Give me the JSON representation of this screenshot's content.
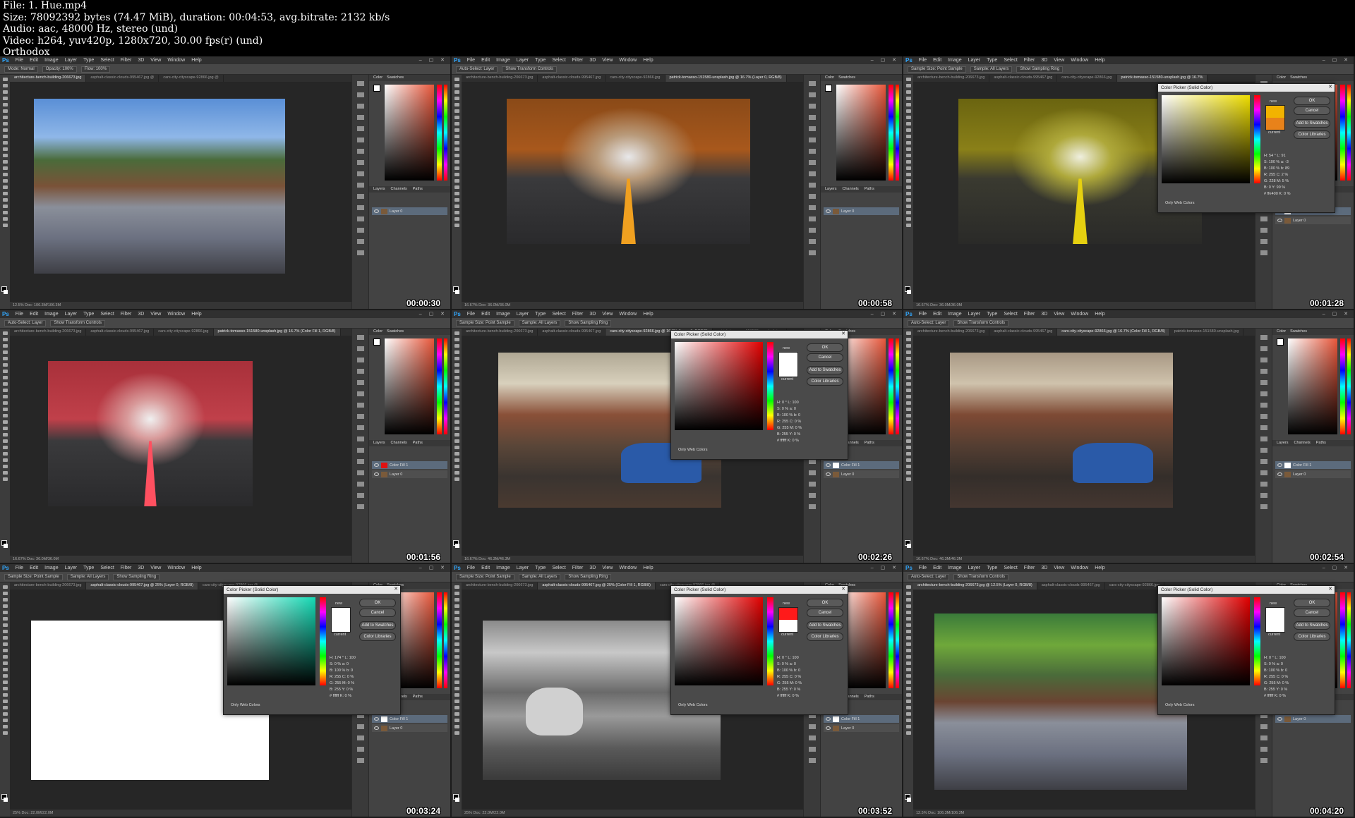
{
  "file_info": {
    "line1": "File: 1. Hue.mp4",
    "line2": "Size: 78092392 bytes (74.47 MiB), duration: 00:04:53, avg.bitrate: 2132 kb/s",
    "line3": "Audio: aac, 48000 Hz, stereo (und)",
    "line4": "Video: h264, yuv420p, 1280x720, 30.00 fps(r) (und)",
    "line5": "Orthodox"
  },
  "ps": {
    "logo": "Ps",
    "menus": [
      "File",
      "Edit",
      "Image",
      "Layer",
      "Type",
      "Select",
      "Filter",
      "3D",
      "View",
      "Window",
      "Help"
    ],
    "window_buttons": "– ▢ ✕",
    "panel_tabs": [
      "Color",
      "Swatches"
    ],
    "layer_tabs": [
      "Layers",
      "Channels",
      "Paths"
    ],
    "layer_names": [
      "Color Fill 1",
      "Layer 0"
    ],
    "dialog": {
      "title": "Color Picker (Solid Color)",
      "close": "✕",
      "new_label": "new",
      "current_label": "current",
      "ok": "OK",
      "cancel": "Cancel",
      "add_swatches": "Add to Swatches",
      "color_libraries": "Color Libraries",
      "only_web": "Only Web Colors"
    }
  },
  "frames": [
    {
      "tabs": [
        "architecture-bench-building-206673.jpg",
        "asphalt-classic-clouds-995467.jpg @",
        "cars-city-cityscape-92866.jpg @"
      ],
      "active_tab": 0,
      "options": [
        "Mode: Normal",
        "Opacity: 100%",
        "Flow: 100%"
      ],
      "status": "12.5%   Doc: 106.3M/106.3M",
      "timestamp": "00:00:30",
      "layers": [
        "Layer 0"
      ]
    },
    {
      "tabs": [
        "architecture-bench-building-206673.jpg",
        "asphalt-classic-clouds-995467.jpg",
        "cars-city-cityscape-92866.jpg",
        "patrick-tomasso-151580-unsplash.jpg @ 16.7% (Layer 0, RGB/8)"
      ],
      "active_tab": 3,
      "options": [
        "Auto-Select: Layer",
        "Show Transform Controls"
      ],
      "status": "16.67%   Doc: 36.0M/36.0M",
      "timestamp": "00:00:58",
      "layers": [
        "Layer 0"
      ]
    },
    {
      "tabs": [
        "architecture-bench-building-206673.jpg",
        "asphalt-classic-clouds-995467.jpg",
        "cars-city-cityscape-92866.jpg",
        "patrick-tomasso-151580-unsplash.jpg @ 16.7%"
      ],
      "active_tab": 3,
      "options": [
        "Sample Size: Point Sample",
        "Sample: All Layers",
        "Show Sampling Ring"
      ],
      "status": "16.67%   Doc: 36.0M/36.0M",
      "timestamp": "00:01:28",
      "layers": [
        "Color Fill 1",
        "Layer 0"
      ],
      "dialog": {
        "field_hue": "#eedd00",
        "new": "#f2b300",
        "current": "#e8821a",
        "values": [
          "H: 54 °   L: 91",
          "S: 100 %   a: -3",
          "B: 100 %   b: 89",
          "R: 255   C: 2 %",
          "G: 228   M: 5 %",
          "B: 0   Y: 99 %",
          "# ffe400   K: 0 %"
        ]
      }
    },
    {
      "tabs": [
        "architecture-bench-building-206673.jpg",
        "asphalt-classic-clouds-995467.jpg",
        "cars-city-cityscape-92866.jpg",
        "patrick-tomasso-151580-unsplash.jpg @ 16.7% (Color Fill 1, RGB/8)"
      ],
      "active_tab": 3,
      "options": [
        "Auto-Select: Layer",
        "Show Transform Controls"
      ],
      "status": "16.67%   Doc: 36.0M/36.0M",
      "timestamp": "00:01:56",
      "layers": [
        "Color Fill 1",
        "Layer 0"
      ],
      "blend": "Hue"
    },
    {
      "tabs": [
        "architecture-bench-building-206673.jpg",
        "asphalt-classic-clouds-995467.jpg",
        "cars-city-cityscape-92866.jpg @ 16.7% (Layer 0, RGB/8)",
        "patrick-tomasso-151580-unsplash.jpg"
      ],
      "active_tab": 2,
      "options": [
        "Sample Size: Point Sample",
        "Sample: All Layers",
        "Show Sampling Ring"
      ],
      "status": "16.67%   Doc: 46.3M/46.3M",
      "timestamp": "00:02:26",
      "layers": [
        "Color Fill 1",
        "Layer 0"
      ],
      "dialog": {
        "field_hue": "#e00000",
        "new": "#ffffff",
        "current": "#ffffff",
        "values": [
          "H: 0 °   L: 100",
          "S: 0 %   a: 0",
          "B: 100 %   b: 0",
          "R: 255   C: 0 %",
          "G: 255   M: 0 %",
          "B: 255   Y: 0 %",
          "# ffffff   K: 0 %"
        ]
      }
    },
    {
      "tabs": [
        "architecture-bench-building-206673.jpg",
        "asphalt-classic-clouds-995467.jpg",
        "cars-city-cityscape-92866.jpg @ 16.7% (Color Fill 1, RGB/8)",
        "patrick-tomasso-151580-unsplash.jpg"
      ],
      "active_tab": 2,
      "options": [
        "Auto-Select: Layer",
        "Show Transform Controls"
      ],
      "status": "16.67%   Doc: 46.3M/46.3M",
      "timestamp": "00:02:54",
      "layers": [
        "Color Fill 1",
        "Layer 0"
      ]
    },
    {
      "tabs": [
        "architecture-bench-building-206673.jpg",
        "asphalt-classic-clouds-995467.jpg @ 25% (Layer 0, RGB/8)",
        "cars-city-cityscape-92866.jpg @"
      ],
      "active_tab": 1,
      "options": [
        "Sample Size: Point Sample",
        "Sample: All Layers",
        "Show Sampling Ring"
      ],
      "status": "25%   Doc: 22.0M/22.0M",
      "timestamp": "00:03:24",
      "layers": [
        "Color Fill 1",
        "Layer 0"
      ],
      "dialog": {
        "field_hue": "#14d9b4",
        "new": "#ffffff",
        "current": "#ffffff",
        "values": [
          "H: 174 °   L: 100",
          "S: 0 %   a: 0",
          "B: 100 %   b: 0",
          "R: 255   C: 0 %",
          "G: 255   M: 0 %",
          "B: 255   Y: 0 %",
          "# ffffff   K: 0 %"
        ]
      }
    },
    {
      "tabs": [
        "architecture-bench-building-206673.jpg",
        "asphalt-classic-clouds-995467.jpg @ 25% (Color Fill 1, RGB/8)",
        "cars-city-cityscape-92866.jpg @"
      ],
      "active_tab": 1,
      "options": [
        "Sample Size: Point Sample",
        "Sample: All Layers",
        "Show Sampling Ring"
      ],
      "status": "25%   Doc: 22.0M/22.0M",
      "timestamp": "00:03:52",
      "layers": [
        "Color Fill 1",
        "Layer 0"
      ],
      "dialog": {
        "field_hue": "#e00000",
        "new": "#ff1a1a",
        "current": "#ffffff",
        "values": [
          "H: 0 °   L: 100",
          "S: 0 %   a: 0",
          "B: 100 %   b: 0",
          "R: 255   C: 0 %",
          "G: 255   M: 0 %",
          "B: 255   Y: 0 %",
          "# ffffff   K: 0 %"
        ]
      }
    },
    {
      "tabs": [
        "architecture-bench-building-206673.jpg @ 12.5% (Layer 0, RGB/8)",
        "asphalt-classic-clouds-995467.jpg",
        "cars-city-cityscape-92866.jpg"
      ],
      "active_tab": 0,
      "options": [
        "Auto-Select: Layer",
        "Show Transform Controls"
      ],
      "status": "12.5%   Doc: 106.3M/106.3M",
      "timestamp": "00:04:20",
      "layers": [
        "Layer 0"
      ],
      "dialog": {
        "field_hue": "#e00000",
        "new": "#ffffff",
        "current": "#ffffff",
        "values": [
          "H: 0 °   L: 100",
          "S: 0 %   a: 0",
          "B: 100 %   b: 0",
          "R: 255   C: 0 %",
          "G: 255   M: 0 %",
          "B: 255   Y: 0 %",
          "# ffffff   K: 0 %"
        ]
      }
    }
  ]
}
